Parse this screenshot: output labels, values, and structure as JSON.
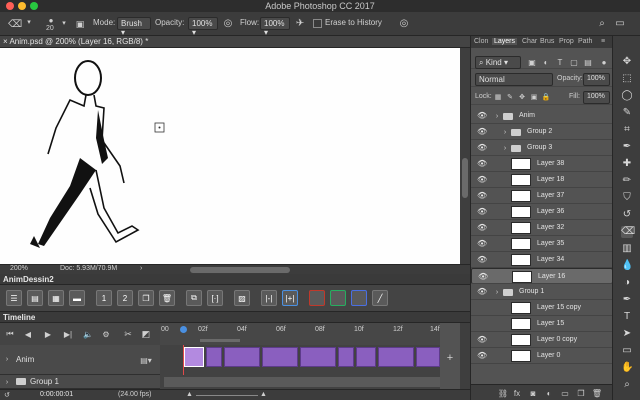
{
  "window": {
    "title": "Adobe Photoshop CC 2017"
  },
  "options": {
    "brush_size": "20",
    "mode_label": "Mode:",
    "mode_value": "Brush",
    "opacity_label": "Opacity:",
    "opacity_value": "100%",
    "flow_label": "Flow:",
    "flow_value": "100%",
    "erase_history_label": "Erase to History"
  },
  "document": {
    "tab_title": "Anim.psd @ 200% (Layer 16, RGB/8) *",
    "zoom": "200%",
    "doc_size": "Doc: 5.93M/70.9M"
  },
  "animdessin": {
    "title": "AnimDessin2"
  },
  "timeline": {
    "title": "Timeline",
    "ruler_ticks": [
      "00",
      "02f",
      "04f",
      "06f",
      "08f",
      "10f",
      "12f",
      "14f"
    ],
    "rows": [
      {
        "label": "Anim"
      },
      {
        "label": "Group 1"
      }
    ],
    "timecode": "0:00:00:01",
    "fps": "(24.00 fps)"
  },
  "panels": {
    "tabs": [
      "Clon",
      "Layers",
      "Char",
      "Brus",
      "Prop",
      "Path"
    ],
    "active_tab": "Layers",
    "kind_label": "Kind",
    "blend_mode": "Normal",
    "opacity_label": "Opacity:",
    "opacity_value": "100%",
    "lock_label": "Lock:",
    "fill_label": "Fill:",
    "fill_value": "100%"
  },
  "layers": [
    {
      "name": "Anim",
      "type": "group",
      "visible": true
    },
    {
      "name": "Group 2",
      "type": "group",
      "visible": true
    },
    {
      "name": "Group 3",
      "type": "group",
      "visible": true
    },
    {
      "name": "Layer 38",
      "type": "layer",
      "visible": true
    },
    {
      "name": "Layer 18",
      "type": "layer",
      "visible": true
    },
    {
      "name": "Layer 37",
      "type": "layer",
      "visible": true
    },
    {
      "name": "Layer 36",
      "type": "layer",
      "visible": true
    },
    {
      "name": "Layer 32",
      "type": "layer",
      "visible": true
    },
    {
      "name": "Layer 35",
      "type": "layer",
      "visible": true
    },
    {
      "name": "Layer 34",
      "type": "layer",
      "visible": true
    },
    {
      "name": "Layer 16",
      "type": "layer",
      "visible": true,
      "selected": true
    },
    {
      "name": "Group 1",
      "type": "group",
      "visible": true
    },
    {
      "name": "Layer 15 copy",
      "type": "layer",
      "visible": false
    },
    {
      "name": "Layer 15",
      "type": "layer",
      "visible": false
    },
    {
      "name": "Layer 0 copy",
      "type": "layer",
      "visible": true
    },
    {
      "name": "Layer 0",
      "type": "layer",
      "visible": true
    }
  ],
  "colors": {
    "frame": "#8a5fbf",
    "playhead": "#4a90e2",
    "selected_layer": "#6a6a6a"
  }
}
